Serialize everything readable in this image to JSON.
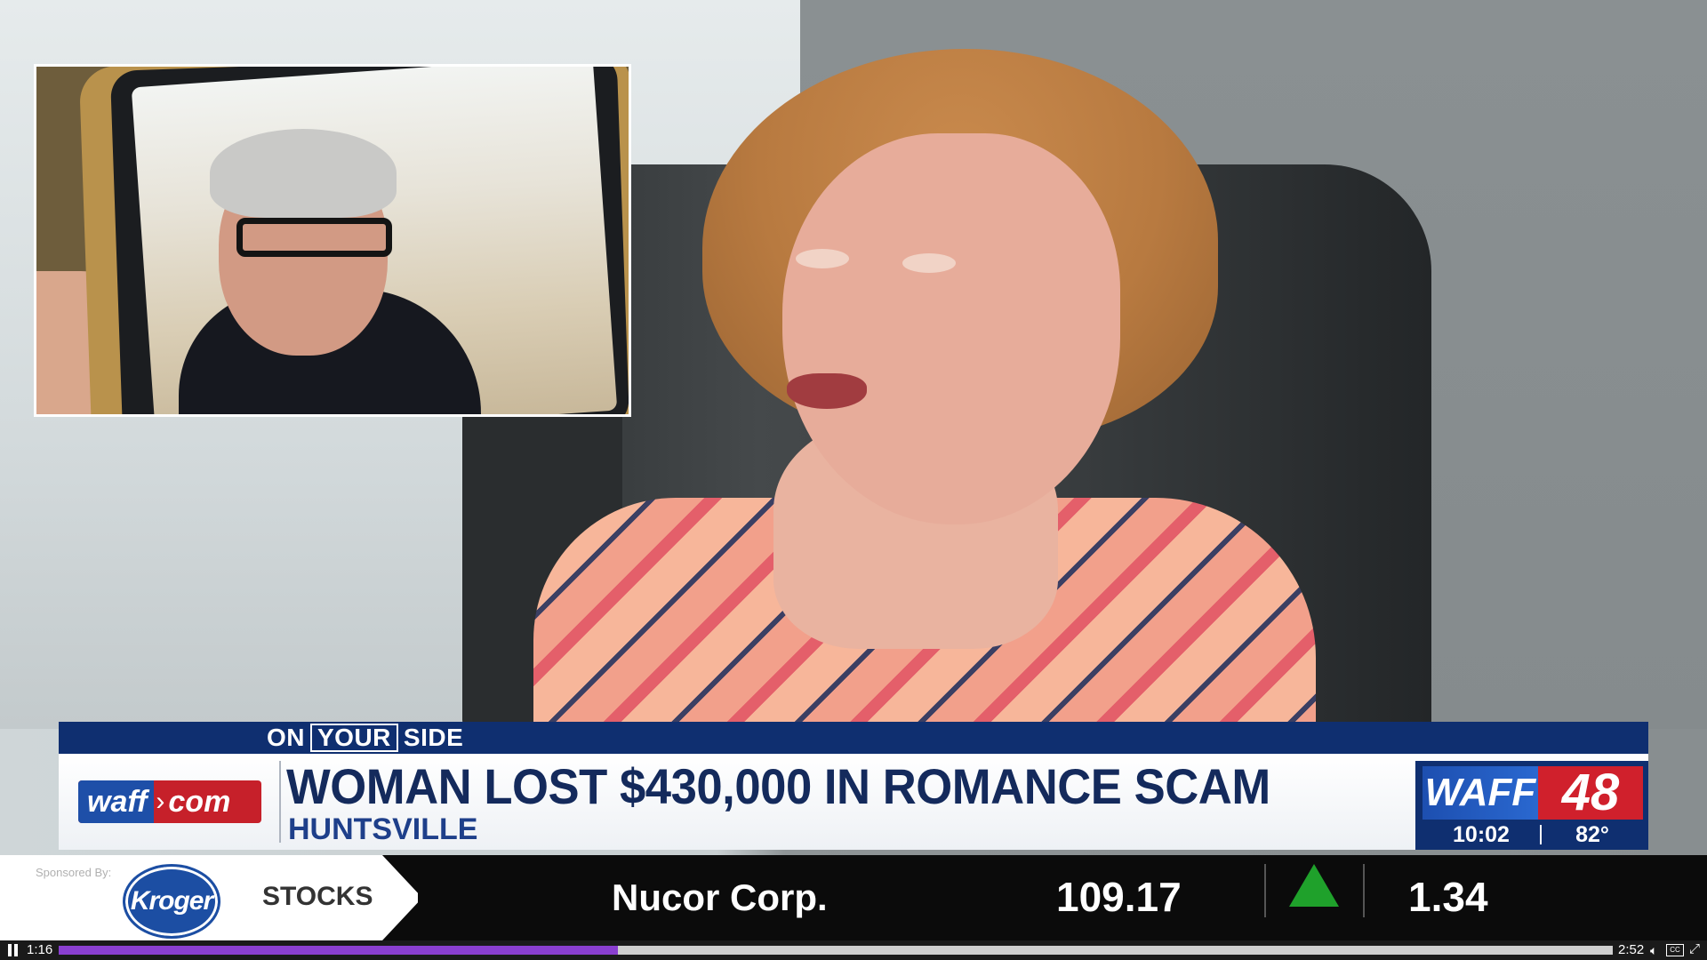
{
  "segment": {
    "on": "ON",
    "your": "YOUR",
    "side": "SIDE"
  },
  "lower_third": {
    "site_logo_left": "waff",
    "site_logo_right": "com",
    "headline": "WOMAN LOST $430,000 IN ROMANCE SCAM",
    "location": "HUNTSVILLE"
  },
  "brand": {
    "waff": "WAFF",
    "channel": "48",
    "time": "10:02",
    "temperature": "82°"
  },
  "ticker": {
    "sponsored_by": "Sponsored By:",
    "sponsor_logo": "Kroger",
    "section": "STOCKS",
    "company": "Nucor Corp.",
    "price": "109.17",
    "change": "1.34",
    "direction": "up",
    "up_color": "#1fa12b"
  },
  "player": {
    "current_time": "1:16",
    "duration": "2:52",
    "progress_fraction": 0.36,
    "progress_color": "#8a3fd0",
    "icons": [
      "pause-icon",
      "volume-icon",
      "closed-captions-icon",
      "fullscreen-icon"
    ]
  },
  "colors": {
    "navy": "#0f2f70",
    "waff_red": "#c6202a",
    "waff_blue": "#1e4fa8",
    "headline": "#142a5c"
  }
}
